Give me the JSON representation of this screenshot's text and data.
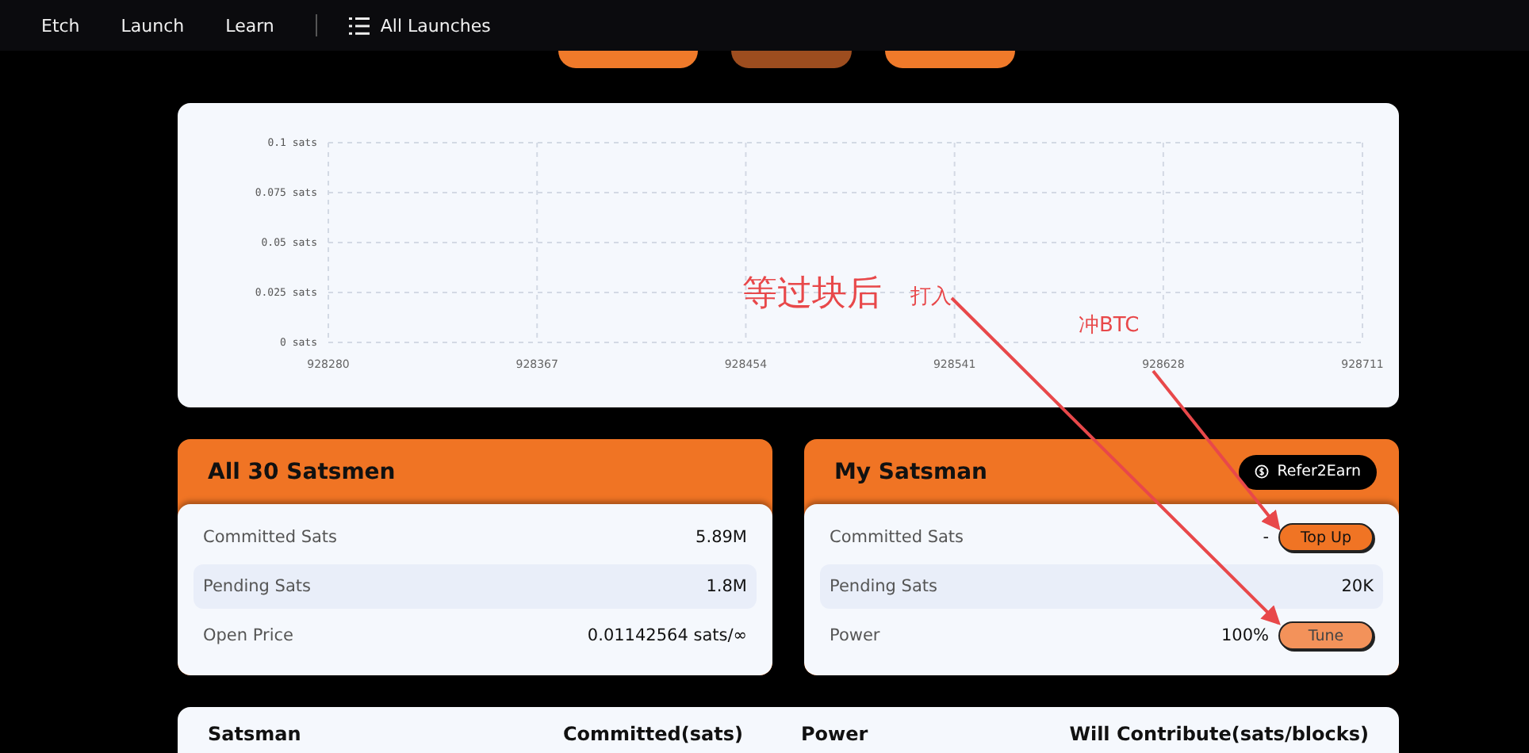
{
  "nav": {
    "links": [
      {
        "label": "Etch"
      },
      {
        "label": "Launch"
      },
      {
        "label": "Learn"
      }
    ],
    "menu": {
      "label": "All Launches"
    }
  },
  "top_buttons": [
    {
      "disabled": false
    },
    {
      "disabled": true
    },
    {
      "disabled": false
    }
  ],
  "chart": {
    "chart_data": {
      "type": "line",
      "xticks": [
        {
          "value": 928280,
          "label": "928280"
        },
        {
          "value": 928367,
          "label": "928367"
        },
        {
          "value": 928454,
          "label": "928454"
        },
        {
          "value": 928541,
          "label": "928541"
        },
        {
          "value": 928628,
          "label": "928628"
        },
        {
          "value": 928711,
          "label": "928711"
        }
      ],
      "yticks": [
        {
          "value": 0.1,
          "label": "0.1 sats"
        },
        {
          "value": 0.075,
          "label": "0.075 sats"
        },
        {
          "value": 0.05,
          "label": "0.05 sats"
        },
        {
          "value": 0.025,
          "label": "0.025 sats"
        },
        {
          "value": 0,
          "label": "0 sats"
        }
      ],
      "xlim": [
        928280,
        928711
      ],
      "ylim": [
        0,
        0.1
      ],
      "grid": true
    }
  },
  "all_card": {
    "title": "All 30 Satsmen",
    "rows": [
      {
        "label": "Committed Sats",
        "value": "5.89M"
      },
      {
        "label": "Pending Sats",
        "value": "1.8M"
      },
      {
        "label": "Open Price",
        "value": "0.01142564 sats/∞"
      }
    ]
  },
  "my_card": {
    "title": "My Satsman",
    "refer_button": "Refer2Earn",
    "rows": [
      {
        "label": "Committed Sats",
        "value": "-",
        "button": {
          "label": "Top Up",
          "kind": "primary"
        }
      },
      {
        "label": "Pending Sats",
        "value": "20K"
      },
      {
        "label": "Power",
        "value": "100%",
        "button": {
          "label": "Tune",
          "kind": "light"
        }
      }
    ]
  },
  "table": {
    "columns": [
      "Satsman",
      "Committed(sats)",
      "Power",
      "Will Contribute(sats/blocks)"
    ]
  },
  "annotations": [
    {
      "text": "等过块后",
      "kind": "heading"
    },
    {
      "text": "打入",
      "kind": "note"
    },
    {
      "text": "冲BTC",
      "kind": "note"
    }
  ]
}
